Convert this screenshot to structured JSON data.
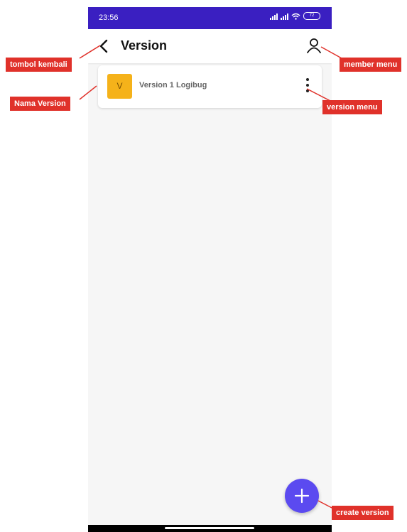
{
  "status_bar": {
    "time": "23:56",
    "battery": "72"
  },
  "app_bar": {
    "title": "Version",
    "back_icon": "chevron-left-icon",
    "member_icon": "person-icon"
  },
  "versions": [
    {
      "avatar_letter": "V",
      "name": "Version 1 Logibug",
      "avatar_color": "#f5b21a"
    }
  ],
  "fab": {
    "icon": "plus-icon",
    "label": "+",
    "color": "#5b4af0"
  },
  "annotations": {
    "back": "tombol kembali",
    "member": "member menu",
    "name": "Nama Version",
    "version_menu": "version menu",
    "create": "create version"
  },
  "colors": {
    "status_bar": "#3a1fc1",
    "callout": "#e0312a"
  }
}
